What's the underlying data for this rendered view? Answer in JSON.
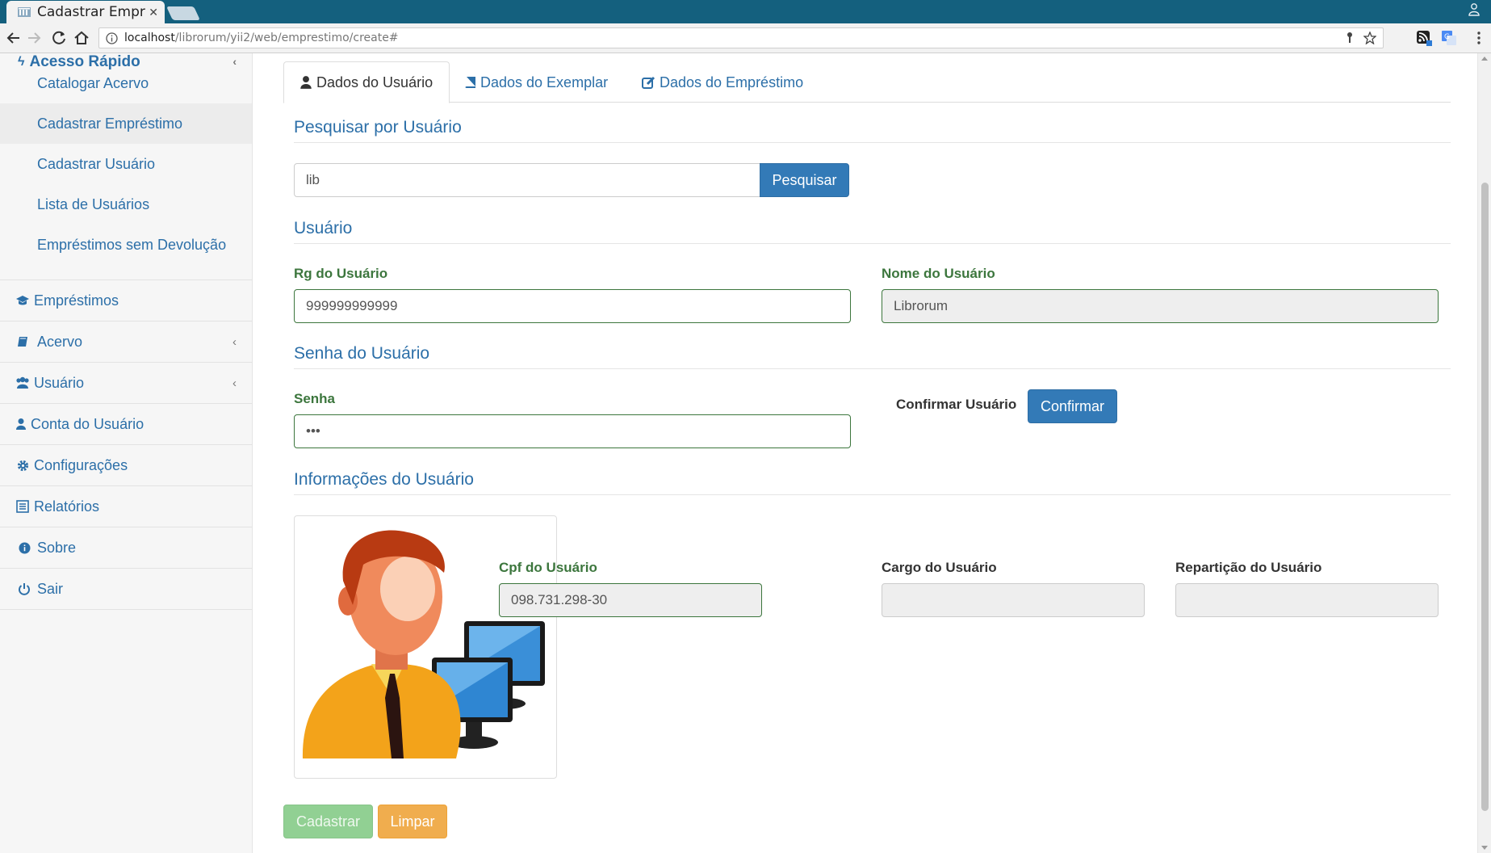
{
  "browser": {
    "tab_title": "Cadastrar Empréstimo",
    "url_host": "localhost",
    "url_path": "/librorum/yii2/web/emprestimo/create#"
  },
  "sidebar": {
    "header": "Acesso Rápido",
    "subitems": [
      {
        "label": "Catalogar Acervo"
      },
      {
        "label": "Cadastrar Empréstimo"
      },
      {
        "label": "Cadastrar Usuário"
      },
      {
        "label": "Lista de Usuários"
      },
      {
        "label": "Empréstimos sem Devolução"
      }
    ],
    "items": [
      {
        "label": "Empréstimos",
        "icon": "graduation-cap-icon"
      },
      {
        "label": "Acervo",
        "icon": "book-icon"
      },
      {
        "label": "Usuário",
        "icon": "users-icon"
      },
      {
        "label": "Conta do Usuário",
        "icon": "user-icon"
      },
      {
        "label": "Configurações",
        "icon": "gear-icon"
      },
      {
        "label": "Relatórios",
        "icon": "list-icon"
      },
      {
        "label": "Sobre",
        "icon": "info-icon"
      },
      {
        "label": "Sair",
        "icon": "power-icon"
      }
    ]
  },
  "tabs": [
    {
      "label": "Dados do Usuário",
      "icon": "user-icon"
    },
    {
      "label": "Dados do Exemplar",
      "icon": "book-icon"
    },
    {
      "label": "Dados do Empréstimo",
      "icon": "edit-icon"
    }
  ],
  "search": {
    "title": "Pesquisar por Usuário",
    "value": "lib",
    "button": "Pesquisar"
  },
  "usuario": {
    "title": "Usuário",
    "rg_label": "Rg do Usuário",
    "rg_value": "999999999999",
    "nome_label": "Nome do Usuário",
    "nome_value": "Librorum"
  },
  "senha": {
    "title": "Senha do Usuário",
    "label": "Senha",
    "value": "•••",
    "confirm_label": "Confirmar Usuário",
    "confirm_button": "Confirmar"
  },
  "info": {
    "title": "Informações do Usuário",
    "cpf_label": "Cpf do Usuário",
    "cpf_value": "098.731.298-30",
    "cargo_label": "Cargo do Usuário",
    "cargo_value": "",
    "reparticao_label": "Repartição do Usuário",
    "reparticao_value": ""
  },
  "actions": {
    "submit": "Cadastrar",
    "reset": "Limpar"
  },
  "colors": {
    "link": "#2c6fa8",
    "success_label": "#3c763d",
    "primary": "#337ab7",
    "warning": "#f0ad4e",
    "chrome": "#14607e"
  }
}
